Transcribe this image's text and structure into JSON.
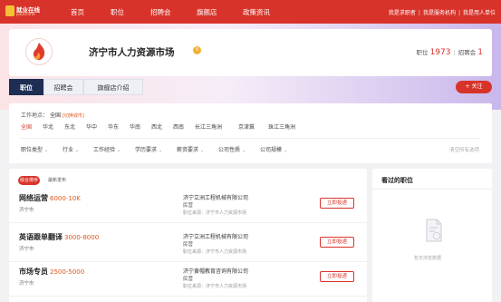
{
  "header": {
    "logo_line1": "就业在线",
    "logo_line2": "jobonline",
    "nav": [
      "首页",
      "职位",
      "招聘会",
      "旗舰店",
      "政策资讯"
    ],
    "links": [
      "我是求职者",
      "我是服务机构",
      "我是用人单位"
    ]
  },
  "market": {
    "name": "济宁市人力资源市场",
    "badge": "V",
    "stats": {
      "jobs_label": "职位",
      "jobs_count": "1973",
      "fairs_label": "招聘会",
      "fairs_count": "1"
    },
    "tabs": [
      "职位",
      "招聘会",
      "旗舰店介绍"
    ],
    "follow_label": "+ 关注"
  },
  "filter": {
    "location_label": "工作地点：",
    "location_value": "全国",
    "location_tag": "[切换城市]",
    "regions": [
      "全国",
      "华北",
      "东北",
      "华中",
      "华东",
      "华南",
      "西北",
      "西南",
      "长江三角洲",
      "京津冀",
      "珠江三角洲"
    ],
    "dropdowns": [
      "职位类型",
      "行业",
      "工作经验",
      "学历要求",
      "薪资要求",
      "公司性质",
      "公司规模"
    ],
    "clear_label": "清空所有选项"
  },
  "jobs": {
    "sort_active": "综合排序",
    "sort_other": "最新发布",
    "apply_label": "立即投递",
    "items": [
      {
        "title": "网络运营",
        "salary": "6000-10K",
        "city": "济宁市",
        "company": "济宁立洲工程机械有限公司",
        "type": "民营",
        "source": "职位来源：济宁市人力资源市场"
      },
      {
        "title": "英语跟单翻译",
        "salary": "3000-8000",
        "city": "济宁市",
        "company": "济宁立洲工程机械有限公司",
        "type": "民营",
        "source": "职位来源：济宁市人力资源市场"
      },
      {
        "title": "市场专员",
        "salary": "2500-5000",
        "city": "济宁市",
        "company": "济宁黄帽教育咨询有限公司",
        "type": "民营",
        "source": "职位来源：济宁市人力资源市场"
      }
    ]
  },
  "viewed": {
    "title": "看过的职位",
    "empty_text": "暂无浏览数据"
  },
  "colors": {
    "brand_red": "#d8332a",
    "salary_orange": "#e0561c",
    "tab_active": "#1d2d54"
  }
}
